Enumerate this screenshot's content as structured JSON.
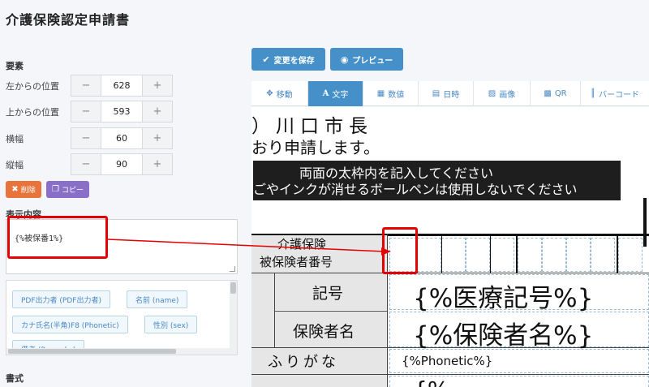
{
  "page_title": "介護保険認定申請書",
  "sidebar": {
    "section_elements": "要素",
    "props": [
      {
        "label": "左からの位置",
        "value": "628"
      },
      {
        "label": "上からの位置",
        "value": "593"
      },
      {
        "label": "横幅",
        "value": "60"
      },
      {
        "label": "縦幅",
        "value": "90"
      }
    ],
    "minus": "−",
    "plus": "+",
    "delete_label": "削除",
    "copy_label": "コピー",
    "section_display": "表示内容",
    "display_value": "{%被保番1%}",
    "tags": [
      "PDF出力者 (PDF出力者)",
      "名前 (name)",
      "カナ氏名(半角)F8 (Phonetic)",
      "性別 (sex)",
      "備考 (Remarks)"
    ],
    "section_format": "書式"
  },
  "toolbar": {
    "save_label": "変更を保存",
    "preview_label": "プレビュー"
  },
  "tabs": [
    "移動",
    "文字",
    "数値",
    "日時",
    "画像",
    "QR",
    "バーコード"
  ],
  "active_tab": "文字",
  "form": {
    "line1": "）川口市長",
    "line2": "おり申請します。",
    "banner1": "両面の太枠内を記入してください",
    "banner2": "消せるボールペンは使用しないでください",
    "banner2_prefix": "ごやインクが",
    "hoken_label1": "介護保険",
    "hoken_label2": "被保険者番号",
    "kigo_label": "記号",
    "kigo_value": "{%医療記号%}",
    "hokensha_label": "保険者名",
    "hokensha_value": "{%保険者名%}",
    "furigana_label": "ふりがな",
    "furigana_value": "{%Phonetic%}",
    "bottom_value": "{%"
  },
  "colors": {
    "accent": "#4590c9",
    "delete": "#e8743b",
    "copy": "#8a6fc9",
    "highlight": "#e60000"
  }
}
